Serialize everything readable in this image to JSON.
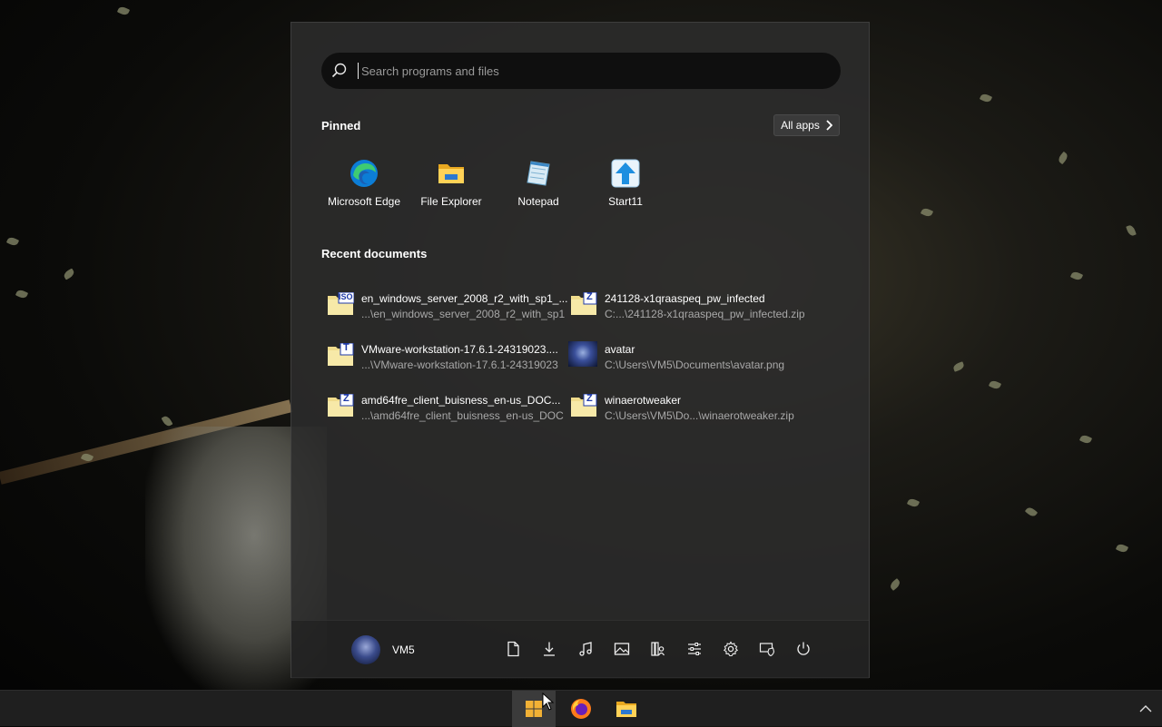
{
  "search": {
    "placeholder": "Search programs and files"
  },
  "pinned": {
    "title": "Pinned",
    "all_apps_label": "All apps",
    "items": [
      {
        "label": "Microsoft Edge",
        "icon": "edge-icon"
      },
      {
        "label": "File Explorer",
        "icon": "folder-icon"
      },
      {
        "label": "Notepad",
        "icon": "notepad-icon"
      },
      {
        "label": "Start11",
        "icon": "start11-icon"
      }
    ]
  },
  "recent": {
    "title": "Recent documents",
    "items": [
      {
        "name": "en_windows_server_2008_r2_with_sp1_...",
        "path": "...\\en_windows_server_2008_r2_with_sp1",
        "badge": "ISO"
      },
      {
        "name": "241128-x1qraaspeq_pw_infected",
        "path": "C:...\\241128-x1qraaspeq_pw_infected.zip",
        "badge": "Z"
      },
      {
        "name": "VMware-workstation-17.6.1-24319023....",
        "path": "...\\VMware-workstation-17.6.1-24319023",
        "badge": "T"
      },
      {
        "name": "avatar",
        "path": "C:\\Users\\VM5\\Documents\\avatar.png",
        "badge": ""
      },
      {
        "name": "amd64fre_client_buisness_en-us_DOC...",
        "path": "...\\amd64fre_client_buisness_en-us_DOC",
        "badge": "Z"
      },
      {
        "name": "winaerotweaker",
        "path": "C:\\Users\\VM5\\Do...\\winaerotweaker.zip",
        "badge": "Z"
      }
    ]
  },
  "user": {
    "name": "VM5"
  },
  "bottom_icons": [
    "documents-icon",
    "downloads-icon",
    "music-icon",
    "pictures-icon",
    "library-icon",
    "settings-sliders-icon",
    "gear-icon",
    "shield-icon",
    "power-icon"
  ],
  "colors": {
    "menu_bg": "#2c2c2c",
    "search_bg": "#0f0f0f",
    "taskbar_bg": "#1f1f1f",
    "badge_blue": "#1f3aa8"
  }
}
